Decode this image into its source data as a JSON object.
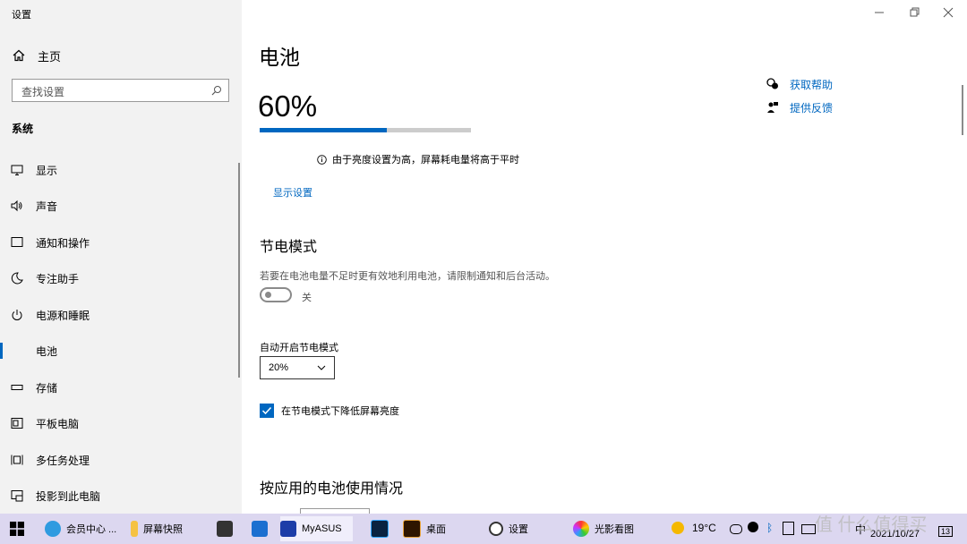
{
  "window": {
    "title": "设置"
  },
  "sidebar": {
    "home": "主页",
    "search_placeholder": "查找设置",
    "category": "系统",
    "items": [
      {
        "label": "显示",
        "icon": "monitor-icon"
      },
      {
        "label": "声音",
        "icon": "speaker-icon"
      },
      {
        "label": "通知和操作",
        "icon": "notification-icon"
      },
      {
        "label": "专注助手",
        "icon": "moon-icon"
      },
      {
        "label": "电源和睡眠",
        "icon": "power-icon"
      },
      {
        "label": "电池",
        "icon": "battery-icon"
      },
      {
        "label": "存储",
        "icon": "storage-icon"
      },
      {
        "label": "平板电脑",
        "icon": "tablet-icon"
      },
      {
        "label": "多任务处理",
        "icon": "multitask-icon"
      },
      {
        "label": "投影到此电脑",
        "icon": "project-icon"
      }
    ]
  },
  "main": {
    "title": "电池",
    "percent_text": "60%",
    "percent_value": 0.6,
    "info_text": "由于亮度设置为高，屏幕耗电量将高于平时",
    "display_link": "显示设置",
    "help": {
      "get_help": "获取帮助",
      "feedback": "提供反馈"
    },
    "saver_heading": "节电模式",
    "saver_desc": "若要在电池电量不足时更有效地利用电池，请限制通知和后台活动。",
    "toggle_label": "关",
    "auto_label": "自动开启节电模式",
    "auto_value": "20%",
    "checkbox_label": "在节电模式下降低屏幕亮度",
    "usage_heading": "按应用的电池使用情况"
  },
  "taskbar": {
    "apps": [
      {
        "label": "会员中心 ...",
        "icon": "edge-icon"
      },
      {
        "label": "屏幕快照",
        "icon": "folder-icon"
      },
      {
        "label": "",
        "icon": "store-icon"
      },
      {
        "label": "",
        "icon": "mail-icon"
      },
      {
        "label": "MyASUS",
        "icon": "myasus-icon"
      },
      {
        "label": "",
        "icon": "photoshop-icon"
      },
      {
        "label": "桌面",
        "icon": "bridge-icon"
      },
      {
        "label": "设置",
        "icon": "gear-icon"
      },
      {
        "label": "光影看图",
        "icon": "photo-viewer-icon"
      }
    ],
    "weather": "19°C",
    "ime": "中",
    "date": "2021/10/27",
    "notif_count": "13"
  },
  "watermark": "值 什么值得买",
  "colors": {
    "accent": "#0067c0",
    "taskbar": "#dcd7f0",
    "sidebar": "#f2f2f2"
  }
}
